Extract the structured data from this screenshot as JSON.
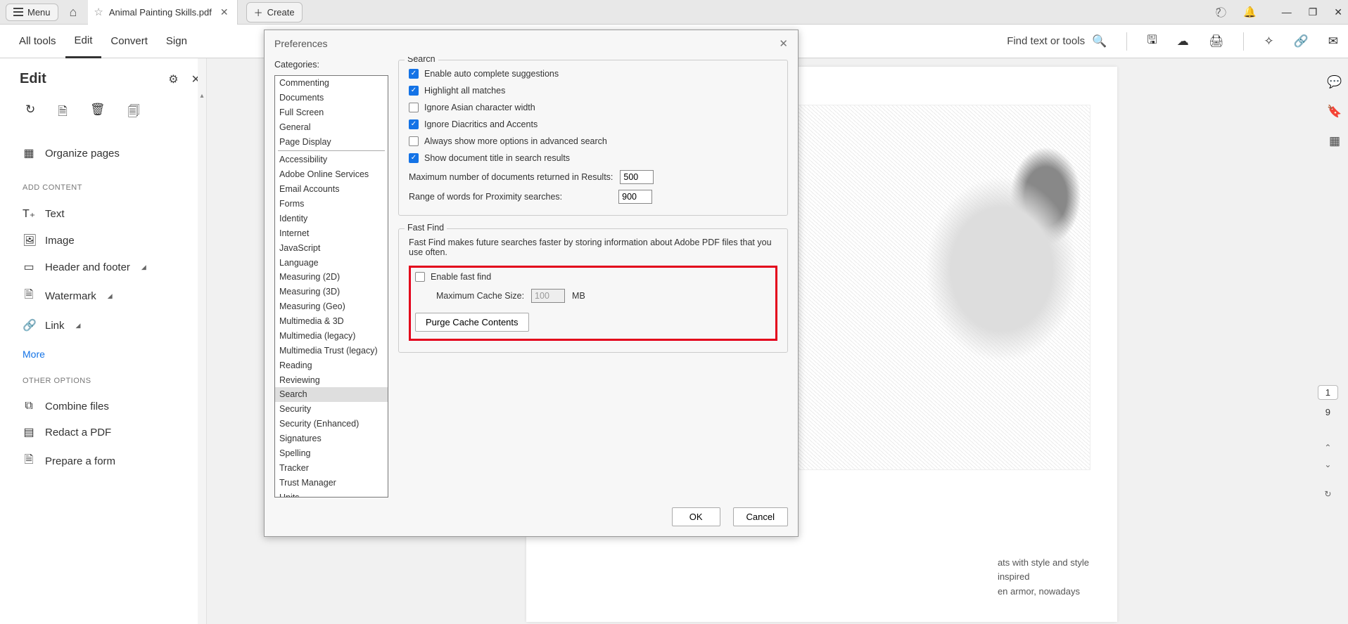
{
  "titlebar": {
    "menu": "Menu",
    "tab_title": "Animal Painting Skills.pdf",
    "create": "Create"
  },
  "toolbar": {
    "tabs": [
      "All tools",
      "Edit",
      "Convert",
      "Sign"
    ],
    "find": "Find text or tools"
  },
  "left_panel": {
    "title": "Edit",
    "organize": "Organize pages",
    "section_add": "ADD CONTENT",
    "text": "Text",
    "image": "Image",
    "header_footer": "Header and footer",
    "watermark": "Watermark",
    "link": "Link",
    "more": "More",
    "section_other": "OTHER OPTIONS",
    "combine": "Combine files",
    "redact": "Redact a PDF",
    "prepare": "Prepare a form"
  },
  "page": {
    "text_line1": "ats with style and style",
    "text_line2": "inspired",
    "text_line3": "en armor, nowadays"
  },
  "page_ind": {
    "current": "1",
    "total": "9"
  },
  "dialog": {
    "title": "Preferences",
    "categories_label": "Categories:",
    "categories_top": [
      "Commenting",
      "Documents",
      "Full Screen",
      "General",
      "Page Display"
    ],
    "categories_rest": [
      "Accessibility",
      "Adobe Online Services",
      "Email Accounts",
      "Forms",
      "Identity",
      "Internet",
      "JavaScript",
      "Language",
      "Measuring (2D)",
      "Measuring (3D)",
      "Measuring (Geo)",
      "Multimedia & 3D",
      "Multimedia (legacy)",
      "Multimedia Trust (legacy)",
      "Reading",
      "Reviewing",
      "Search",
      "Security",
      "Security (Enhanced)",
      "Signatures",
      "Spelling",
      "Tracker",
      "Trust Manager",
      "Units"
    ],
    "selected_category": "Search",
    "group_search": "Search",
    "chk_autocomplete": "Enable auto complete suggestions",
    "chk_highlight": "Highlight all matches",
    "chk_asian": "Ignore Asian character width",
    "chk_diacritics": "Ignore Diacritics and Accents",
    "chk_advanced": "Always show more options in advanced search",
    "chk_doctitle": "Show document title in search results",
    "max_docs_label": "Maximum number of documents returned in Results:",
    "max_docs_value": "500",
    "proximity_label": "Range of words for Proximity searches:",
    "proximity_value": "900",
    "group_fastfind": "Fast Find",
    "fastfind_desc": "Fast Find makes future searches faster by storing information about Adobe PDF files that you use often.",
    "chk_enable_ff": "Enable fast find",
    "cache_label": "Maximum Cache Size:",
    "cache_value": "100",
    "cache_unit": "MB",
    "purge_btn": "Purge Cache Contents",
    "ok": "OK",
    "cancel": "Cancel"
  }
}
